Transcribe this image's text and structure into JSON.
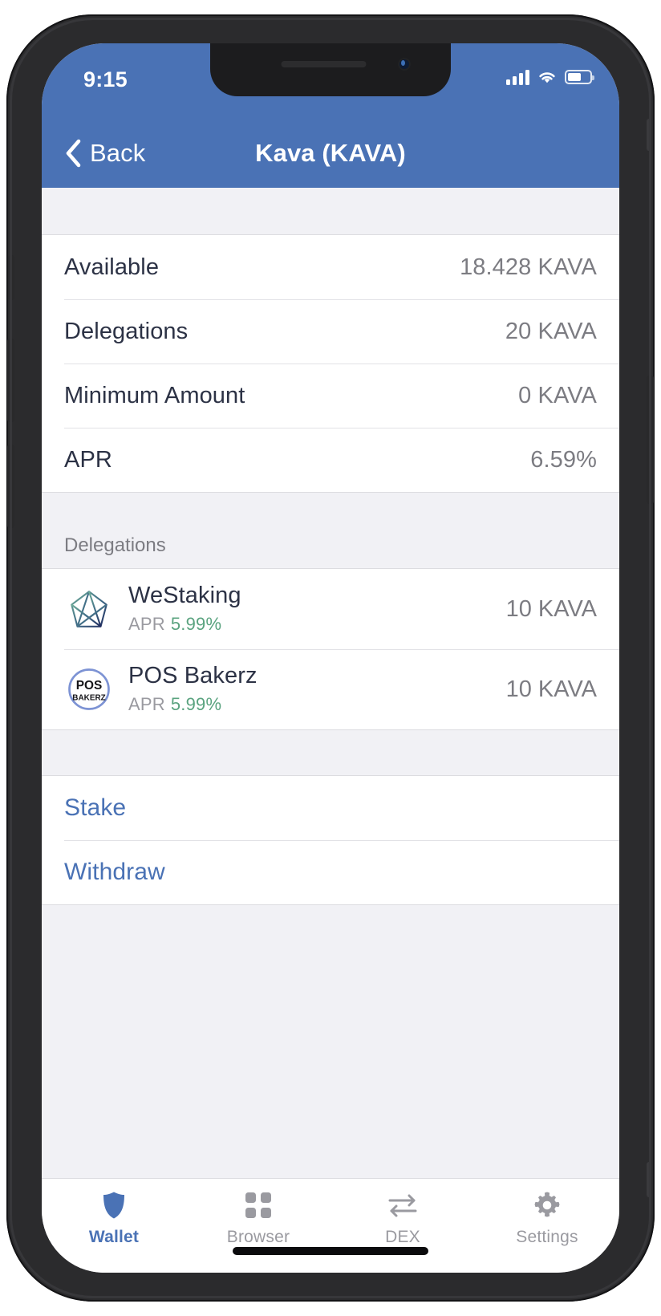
{
  "status_bar": {
    "time": "9:15",
    "signal_icon": "cellular-signal-icon",
    "wifi_icon": "wifi-icon",
    "battery_icon": "battery-icon",
    "battery_level_pct": 62
  },
  "nav": {
    "back_label": "Back",
    "back_icon": "chevron-left-icon",
    "title": "Kava (KAVA)"
  },
  "colors": {
    "header_blue": "#4a72b5",
    "link_blue": "#4a72b5",
    "apr_green": "#5aa37f",
    "value_gray": "#7c7c82",
    "label_dark": "#2c3245",
    "page_bg": "#f1f1f5"
  },
  "info_rows": [
    {
      "label": "Available",
      "value": "18.428 KAVA"
    },
    {
      "label": "Delegations",
      "value": "20 KAVA"
    },
    {
      "label": "Minimum Amount",
      "value": "0 KAVA"
    },
    {
      "label": "APR",
      "value": "6.59%"
    }
  ],
  "delegations_section": {
    "header": "Delegations",
    "items": [
      {
        "name": "WeStaking",
        "logo_icon": "westaking-logo-icon",
        "apr_label": "APR",
        "apr_value": "5.99%",
        "amount": "10 KAVA"
      },
      {
        "name": "POS Bakerz",
        "logo_icon": "pos-bakerz-logo-icon",
        "logo_text_top": "POS",
        "logo_text_bottom": "BAKERZ",
        "apr_label": "APR",
        "apr_value": "5.99%",
        "amount": "10 KAVA"
      }
    ]
  },
  "actions": [
    {
      "label": "Stake"
    },
    {
      "label": "Withdraw"
    }
  ],
  "tab_bar": {
    "items": [
      {
        "label": "Wallet",
        "icon": "shield-icon",
        "active": true
      },
      {
        "label": "Browser",
        "icon": "grid-icon",
        "active": false
      },
      {
        "label": "DEX",
        "icon": "swap-arrows-icon",
        "active": false
      },
      {
        "label": "Settings",
        "icon": "gear-icon",
        "active": false
      }
    ]
  }
}
